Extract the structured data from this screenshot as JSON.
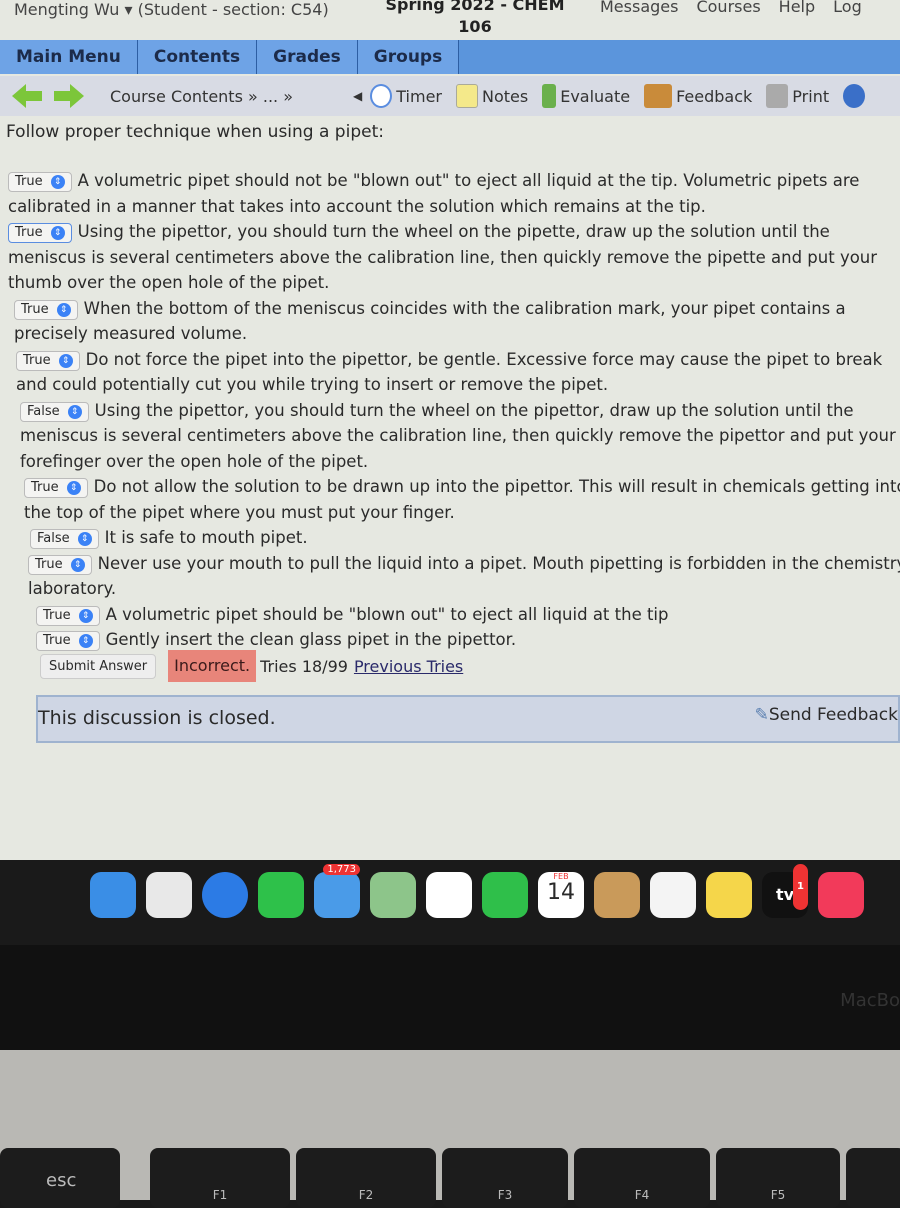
{
  "header": {
    "user": "Mengting Wu ▾ (Student  - section: C54)",
    "course": "Spring 2022 - CHEM 106",
    "links": [
      "Messages",
      "Courses",
      "Help",
      "Log"
    ]
  },
  "menu": [
    "Main Menu",
    "Contents",
    "Grades",
    "Groups"
  ],
  "toolbar": {
    "breadcrumb": "Course Contents » ... »",
    "timer": "Timer",
    "notes": "Notes",
    "evaluate": "Evaluate",
    "feedback": "Feedback",
    "print": "Print"
  },
  "intro": "Follow proper technique when using a pipet:",
  "questions": [
    {
      "answer": "True",
      "text": "A volumetric pipet should not be \"blown out\" to eject all liquid at the tip. Volumetric pipets are calibrated in a manner that takes into account the solution which remains at the tip."
    },
    {
      "answer": "True",
      "text": "Using the pipettor, you should turn the wheel on the pipette, draw up the solution until the meniscus is several centimeters above the calibration line, then quickly remove the pipette and put your thumb over the open hole of the pipet."
    },
    {
      "answer": "True",
      "text": "When the bottom of the meniscus coincides with the calibration mark, your pipet contains a precisely measured volume."
    },
    {
      "answer": "True",
      "text": "Do not force the pipet into the pipettor, be gentle. Excessive force may cause the pipet to break and could potentially cut you while trying to insert or remove the pipet."
    },
    {
      "answer": "False",
      "text": "Using the pipettor, you should turn the wheel on the pipettor, draw up the solution until the meniscus is several centimeters above the calibration line, then quickly remove the pipettor and put your forefinger over the open hole of the pipet."
    },
    {
      "answer": "True",
      "text": "Do not allow the solution to be drawn up into the pipettor. This will result in chemicals getting into the top of the pipet where you must put your finger."
    },
    {
      "answer": "False",
      "text": "It is safe to mouth pipet."
    },
    {
      "answer": "True",
      "text": "Never use your mouth to pull the liquid into a pipet. Mouth pipetting is forbidden in the chemistry laboratory."
    },
    {
      "answer": "True",
      "text": "A volumetric pipet should be \"blown out\" to eject all liquid at the tip"
    },
    {
      "answer": "True",
      "text": "Gently insert the clean glass pipet in the pipettor."
    }
  ],
  "submit": {
    "button": "Submit Answer",
    "status": "Incorrect.",
    "tries": "Tries 18/99",
    "previous": "Previous Tries",
    "status_color": "#e8857a"
  },
  "discussion": {
    "text": "This discussion is closed.",
    "send_feedback": "Send Feedback"
  },
  "dock": {
    "mail_badge": "1,773",
    "calendar_month": "FEB",
    "calendar_day": "14",
    "tv": "tv",
    "tv_badge": "1"
  },
  "laptop": {
    "brand": "MacBo"
  },
  "keys": [
    "esc",
    "F1",
    "F2",
    "F3",
    "F4",
    "F5"
  ]
}
